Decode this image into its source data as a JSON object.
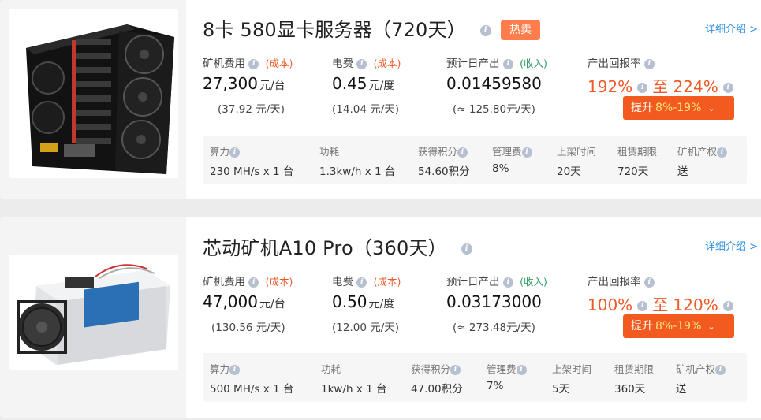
{
  "products": [
    {
      "title": "8卡 580显卡服务器（720天）",
      "hot_badge": "热卖",
      "detail_link": "详细介绍 >",
      "fee_label": "矿机费用",
      "fee_tag": "(成本)",
      "fee_value": "27,300",
      "fee_unit": "元/台",
      "fee_sub": "(37.92 元/天)",
      "elec_label": "电费",
      "elec_tag": "(成本)",
      "elec_value": "0.45",
      "elec_unit": "元/度",
      "elec_sub": "(14.04 元/天)",
      "output_label": "预计日产出",
      "output_tag": "(收入)",
      "output_value": "0.01459580",
      "output_sub": "(≈ 125.80元/天)",
      "rate_label": "产出回报率",
      "rate_low": "192%",
      "rate_to": "至",
      "rate_high": "224%",
      "boost_label": "提升",
      "boost_pct": "8%-19%",
      "specs": [
        {
          "label": "算力",
          "value": "230 MH/s x 1 台"
        },
        {
          "label": "功耗",
          "value": "1.3kw/h x 1 台"
        },
        {
          "label": "获得积分",
          "value": "54.60积分"
        },
        {
          "label": "管理费",
          "value": "8%"
        },
        {
          "label": "上架时间",
          "value": "20天"
        },
        {
          "label": "租赁期限",
          "value": "720天"
        },
        {
          "label": "矿机产权",
          "value": "送"
        }
      ]
    },
    {
      "title": "芯动矿机A10 Pro（360天）",
      "detail_link": "详细介绍 >",
      "fee_label": "矿机费用",
      "fee_tag": "(成本)",
      "fee_value": "47,000",
      "fee_unit": "元/台",
      "fee_sub": "(130.56 元/天)",
      "elec_label": "电费",
      "elec_tag": "(成本)",
      "elec_value": "0.50",
      "elec_unit": "元/度",
      "elec_sub": "(12.00 元/天)",
      "output_label": "预计日产出",
      "output_tag": "(收入)",
      "output_value": "0.03173000",
      "output_sub": "(≈ 273.48元/天)",
      "rate_label": "产出回报率",
      "rate_low": "100%",
      "rate_to": "至",
      "rate_high": "120%",
      "boost_label": "提升",
      "boost_pct": "8%-19%",
      "specs": [
        {
          "label": "算力",
          "value": "500 MH/s x 1 台"
        },
        {
          "label": "功耗",
          "value": "1kw/h x 1 台"
        },
        {
          "label": "获得积分",
          "value": "47.00积分"
        },
        {
          "label": "管理费",
          "value": "7%"
        },
        {
          "label": "上架时间",
          "value": "5天"
        },
        {
          "label": "租赁期限",
          "value": "360天"
        },
        {
          "label": "矿机产权",
          "value": "送"
        }
      ]
    }
  ],
  "icons": {
    "info": "info-circle-icon",
    "chevron": "chevron-down-icon"
  },
  "colors": {
    "accent_orange": "#f25a1f",
    "rate_text": "#ef5a28",
    "link_blue": "#2e8fe0",
    "income_green": "#2e9b62",
    "hot_badge": "#ff7d4d"
  }
}
